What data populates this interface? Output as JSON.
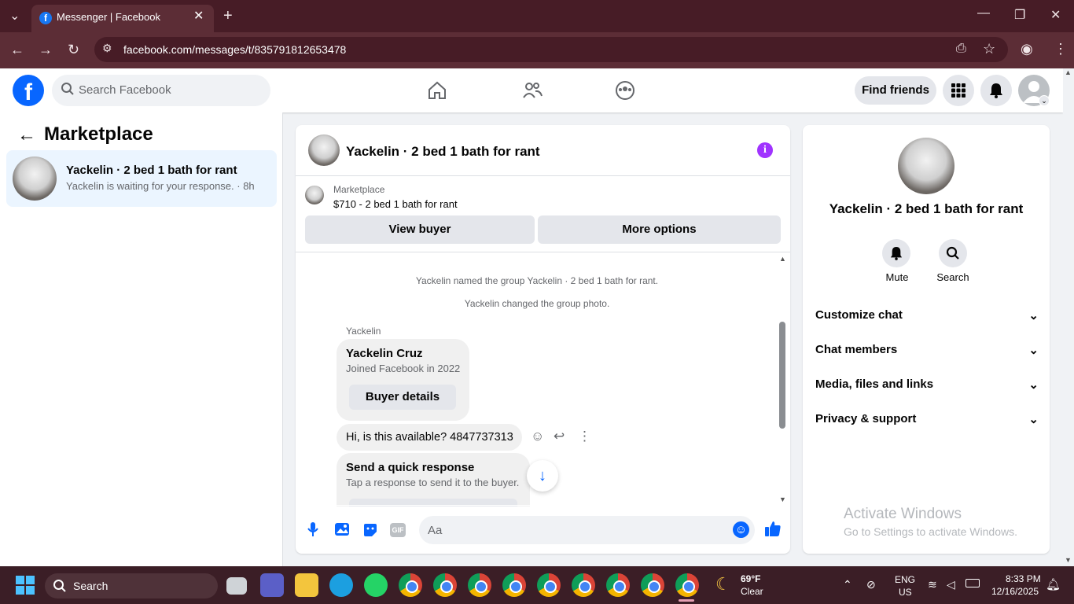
{
  "browser": {
    "tab_title": "Messenger | Facebook",
    "url": "facebook.com/messages/t/835791812653478"
  },
  "header": {
    "search_placeholder": "Search Facebook",
    "find_friends": "Find friends"
  },
  "left": {
    "title": "Marketplace",
    "conversation": {
      "name": "Yackelin · 2 bed 1 bath for rant",
      "preview": "Yackelin is waiting for your response. · 8h"
    }
  },
  "chat": {
    "title": "Yackelin · 2 bed 1 bath for rant",
    "listing_label": "Marketplace",
    "listing_price": "$710 - 2 bed 1 bath for rant",
    "view_buyer": "View buyer",
    "more_options": "More options",
    "system_messages": [
      "Yackelin named the group Yackelin · 2 bed 1 bath for rant.",
      "Yackelin changed the group photo."
    ],
    "sender": "Yackelin",
    "card_name": "Yackelin Cruz",
    "card_sub": "Joined Facebook in 2022",
    "buyer_details": "Buyer details",
    "message": "Hi, is this available? 4847737313",
    "quick_title": "Send a quick response",
    "quick_sub": "Tap a response to send it to the buyer.",
    "composer_placeholder": "Aa"
  },
  "right": {
    "title": "Yackelin · 2 bed 1 bath for rant",
    "mute": "Mute",
    "search": "Search",
    "sections": [
      "Customize chat",
      "Chat members",
      "Media, files and links",
      "Privacy & support"
    ]
  },
  "watermark": {
    "line1": "Activate Windows",
    "line2": "Go to Settings to activate Windows."
  },
  "taskbar": {
    "search": "Search",
    "weather_temp": "69°F",
    "weather_desc": "Clear",
    "lang1": "ENG",
    "lang2": "US",
    "time": "8:33 PM",
    "date": "12/16/2025"
  },
  "colors": {
    "fb_blue": "#0866ff",
    "purple": "#a033ff",
    "chrome_bg": "#5c2d36"
  }
}
